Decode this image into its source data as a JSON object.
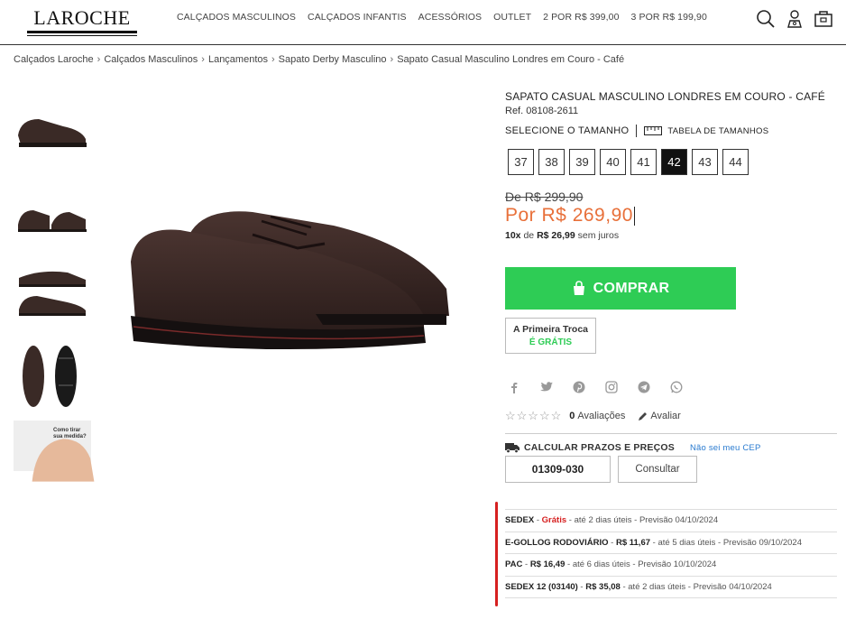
{
  "header": {
    "logo": "LAROCHE",
    "nav": [
      "CALÇADOS MASCULINOS",
      "CALÇADOS INFANTIS",
      "ACESSÓRIOS",
      "OUTLET",
      "2 POR R$ 399,00",
      "3 POR R$ 199,90"
    ],
    "icons": [
      "search-icon",
      "user-icon",
      "bag-icon"
    ]
  },
  "breadcrumb": [
    "Calçados Laroche",
    "Calçados Masculinos",
    "Lançamentos",
    "Sapato Derby Masculino",
    "Sapato Casual Masculino Londres em Couro - Café"
  ],
  "product": {
    "title": "SAPATO CASUAL MASCULINO LONDRES EM COURO - CAFÉ",
    "ref": "Ref. 08108-2611",
    "size_label": "SELECIONE O TAMANHO",
    "size_table_label": "TABELA DE TAMANHOS",
    "sizes": [
      "37",
      "38",
      "39",
      "40",
      "41",
      "42",
      "43",
      "44"
    ],
    "selected_size": "42",
    "old_price": "De R$ 299,90",
    "new_price": "Por R$ 269,90",
    "installments_count": "10x",
    "installments_of": "de",
    "installments_value": "R$ 26,99",
    "installments_suffix": "sem juros",
    "buy_label": "COMPRAR",
    "exchange_line1": "A Primeira Troca",
    "exchange_line2": "É GRÁTIS",
    "thumb_text": "Como tirar sua medida?"
  },
  "share_icons": [
    "facebook-icon",
    "twitter-icon",
    "pinterest-icon",
    "instagram-icon",
    "telegram-icon",
    "whatsapp-icon"
  ],
  "ratings": {
    "stars": "☆☆☆☆☆",
    "count": "0",
    "label": "Avaliações",
    "rate_label": "Avaliar"
  },
  "shipping": {
    "title": "CALCULAR PRAZOS E PREÇOS",
    "cep_help": "Não sei meu CEP",
    "cep_value": "01309-030",
    "consult_label": "Consultar",
    "options": [
      {
        "name": "SEDEX",
        "price": "Grátis",
        "free": true,
        "eta": "até 2 dias úteis",
        "forecast": "Previsão 04/10/2024"
      },
      {
        "name": "E-GOLLOG RODOVIÁRIO",
        "price": "R$ 11,67",
        "free": false,
        "eta": "até 5 dias úteis",
        "forecast": "Previsão 09/10/2024"
      },
      {
        "name": "PAC",
        "price": "R$ 16,49",
        "free": false,
        "eta": "até 6 dias úteis",
        "forecast": "Previsão 10/10/2024"
      },
      {
        "name": "SEDEX 12 (03140)",
        "price": "R$ 35,08",
        "free": false,
        "eta": "até 2 dias úteis",
        "forecast": "Previsão 04/10/2024"
      }
    ]
  },
  "colors": {
    "price": "#e8703a",
    "buy": "#2ecc55",
    "accent_red": "#d62020",
    "link": "#2a7bd0"
  }
}
